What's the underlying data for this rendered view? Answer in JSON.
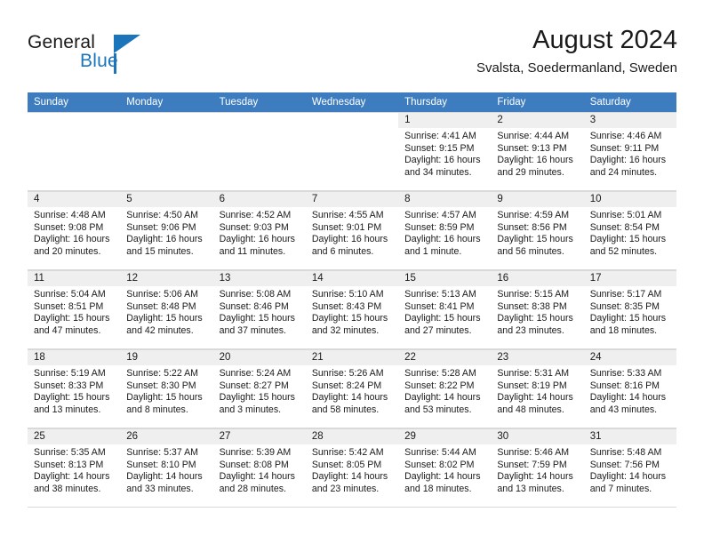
{
  "brand": {
    "name_part1": "General",
    "name_part2": "Blue",
    "accent_color": "#1b75bb",
    "logo_icon": "triangle-flag-icon"
  },
  "header": {
    "title": "August 2024",
    "subtitle": "Svalsta, Soedermanland, Sweden"
  },
  "calendar": {
    "header_bg": "#3d7dbf",
    "daynum_bg": "#efefef",
    "weekday_headers": [
      "Sunday",
      "Monday",
      "Tuesday",
      "Wednesday",
      "Thursday",
      "Friday",
      "Saturday"
    ],
    "weeks": [
      [
        {
          "day": "",
          "empty": true
        },
        {
          "day": "",
          "empty": true
        },
        {
          "day": "",
          "empty": true
        },
        {
          "day": "",
          "empty": true
        },
        {
          "day": "1",
          "sunrise": "Sunrise: 4:41 AM",
          "sunset": "Sunset: 9:15 PM",
          "daylight": "Daylight: 16 hours and 34 minutes."
        },
        {
          "day": "2",
          "sunrise": "Sunrise: 4:44 AM",
          "sunset": "Sunset: 9:13 PM",
          "daylight": "Daylight: 16 hours and 29 minutes."
        },
        {
          "day": "3",
          "sunrise": "Sunrise: 4:46 AM",
          "sunset": "Sunset: 9:11 PM",
          "daylight": "Daylight: 16 hours and 24 minutes."
        }
      ],
      [
        {
          "day": "4",
          "sunrise": "Sunrise: 4:48 AM",
          "sunset": "Sunset: 9:08 PM",
          "daylight": "Daylight: 16 hours and 20 minutes."
        },
        {
          "day": "5",
          "sunrise": "Sunrise: 4:50 AM",
          "sunset": "Sunset: 9:06 PM",
          "daylight": "Daylight: 16 hours and 15 minutes."
        },
        {
          "day": "6",
          "sunrise": "Sunrise: 4:52 AM",
          "sunset": "Sunset: 9:03 PM",
          "daylight": "Daylight: 16 hours and 11 minutes."
        },
        {
          "day": "7",
          "sunrise": "Sunrise: 4:55 AM",
          "sunset": "Sunset: 9:01 PM",
          "daylight": "Daylight: 16 hours and 6 minutes."
        },
        {
          "day": "8",
          "sunrise": "Sunrise: 4:57 AM",
          "sunset": "Sunset: 8:59 PM",
          "daylight": "Daylight: 16 hours and 1 minute."
        },
        {
          "day": "9",
          "sunrise": "Sunrise: 4:59 AM",
          "sunset": "Sunset: 8:56 PM",
          "daylight": "Daylight: 15 hours and 56 minutes."
        },
        {
          "day": "10",
          "sunrise": "Sunrise: 5:01 AM",
          "sunset": "Sunset: 8:54 PM",
          "daylight": "Daylight: 15 hours and 52 minutes."
        }
      ],
      [
        {
          "day": "11",
          "sunrise": "Sunrise: 5:04 AM",
          "sunset": "Sunset: 8:51 PM",
          "daylight": "Daylight: 15 hours and 47 minutes."
        },
        {
          "day": "12",
          "sunrise": "Sunrise: 5:06 AM",
          "sunset": "Sunset: 8:48 PM",
          "daylight": "Daylight: 15 hours and 42 minutes."
        },
        {
          "day": "13",
          "sunrise": "Sunrise: 5:08 AM",
          "sunset": "Sunset: 8:46 PM",
          "daylight": "Daylight: 15 hours and 37 minutes."
        },
        {
          "day": "14",
          "sunrise": "Sunrise: 5:10 AM",
          "sunset": "Sunset: 8:43 PM",
          "daylight": "Daylight: 15 hours and 32 minutes."
        },
        {
          "day": "15",
          "sunrise": "Sunrise: 5:13 AM",
          "sunset": "Sunset: 8:41 PM",
          "daylight": "Daylight: 15 hours and 27 minutes."
        },
        {
          "day": "16",
          "sunrise": "Sunrise: 5:15 AM",
          "sunset": "Sunset: 8:38 PM",
          "daylight": "Daylight: 15 hours and 23 minutes."
        },
        {
          "day": "17",
          "sunrise": "Sunrise: 5:17 AM",
          "sunset": "Sunset: 8:35 PM",
          "daylight": "Daylight: 15 hours and 18 minutes."
        }
      ],
      [
        {
          "day": "18",
          "sunrise": "Sunrise: 5:19 AM",
          "sunset": "Sunset: 8:33 PM",
          "daylight": "Daylight: 15 hours and 13 minutes."
        },
        {
          "day": "19",
          "sunrise": "Sunrise: 5:22 AM",
          "sunset": "Sunset: 8:30 PM",
          "daylight": "Daylight: 15 hours and 8 minutes."
        },
        {
          "day": "20",
          "sunrise": "Sunrise: 5:24 AM",
          "sunset": "Sunset: 8:27 PM",
          "daylight": "Daylight: 15 hours and 3 minutes."
        },
        {
          "day": "21",
          "sunrise": "Sunrise: 5:26 AM",
          "sunset": "Sunset: 8:24 PM",
          "daylight": "Daylight: 14 hours and 58 minutes."
        },
        {
          "day": "22",
          "sunrise": "Sunrise: 5:28 AM",
          "sunset": "Sunset: 8:22 PM",
          "daylight": "Daylight: 14 hours and 53 minutes."
        },
        {
          "day": "23",
          "sunrise": "Sunrise: 5:31 AM",
          "sunset": "Sunset: 8:19 PM",
          "daylight": "Daylight: 14 hours and 48 minutes."
        },
        {
          "day": "24",
          "sunrise": "Sunrise: 5:33 AM",
          "sunset": "Sunset: 8:16 PM",
          "daylight": "Daylight: 14 hours and 43 minutes."
        }
      ],
      [
        {
          "day": "25",
          "sunrise": "Sunrise: 5:35 AM",
          "sunset": "Sunset: 8:13 PM",
          "daylight": "Daylight: 14 hours and 38 minutes."
        },
        {
          "day": "26",
          "sunrise": "Sunrise: 5:37 AM",
          "sunset": "Sunset: 8:10 PM",
          "daylight": "Daylight: 14 hours and 33 minutes."
        },
        {
          "day": "27",
          "sunrise": "Sunrise: 5:39 AM",
          "sunset": "Sunset: 8:08 PM",
          "daylight": "Daylight: 14 hours and 28 minutes."
        },
        {
          "day": "28",
          "sunrise": "Sunrise: 5:42 AM",
          "sunset": "Sunset: 8:05 PM",
          "daylight": "Daylight: 14 hours and 23 minutes."
        },
        {
          "day": "29",
          "sunrise": "Sunrise: 5:44 AM",
          "sunset": "Sunset: 8:02 PM",
          "daylight": "Daylight: 14 hours and 18 minutes."
        },
        {
          "day": "30",
          "sunrise": "Sunrise: 5:46 AM",
          "sunset": "Sunset: 7:59 PM",
          "daylight": "Daylight: 14 hours and 13 minutes."
        },
        {
          "day": "31",
          "sunrise": "Sunrise: 5:48 AM",
          "sunset": "Sunset: 7:56 PM",
          "daylight": "Daylight: 14 hours and 7 minutes."
        }
      ]
    ]
  }
}
